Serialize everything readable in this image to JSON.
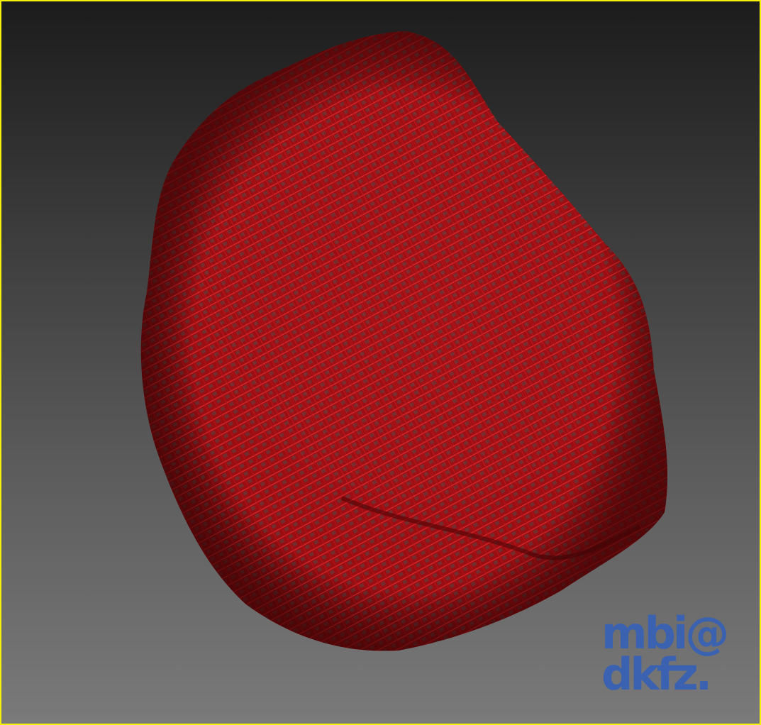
{
  "viewer": {
    "border_color": "#f2f20a",
    "background_top": "#1c1c1c",
    "background_bottom": "#7a7a7a"
  },
  "surface": {
    "color": "#c8141a",
    "shade": "#7a0a0c",
    "highlight": "#ff4a4a"
  },
  "logo": {
    "line1": "mbi@",
    "line2": "dkfz.",
    "color": "#3a62b0"
  }
}
